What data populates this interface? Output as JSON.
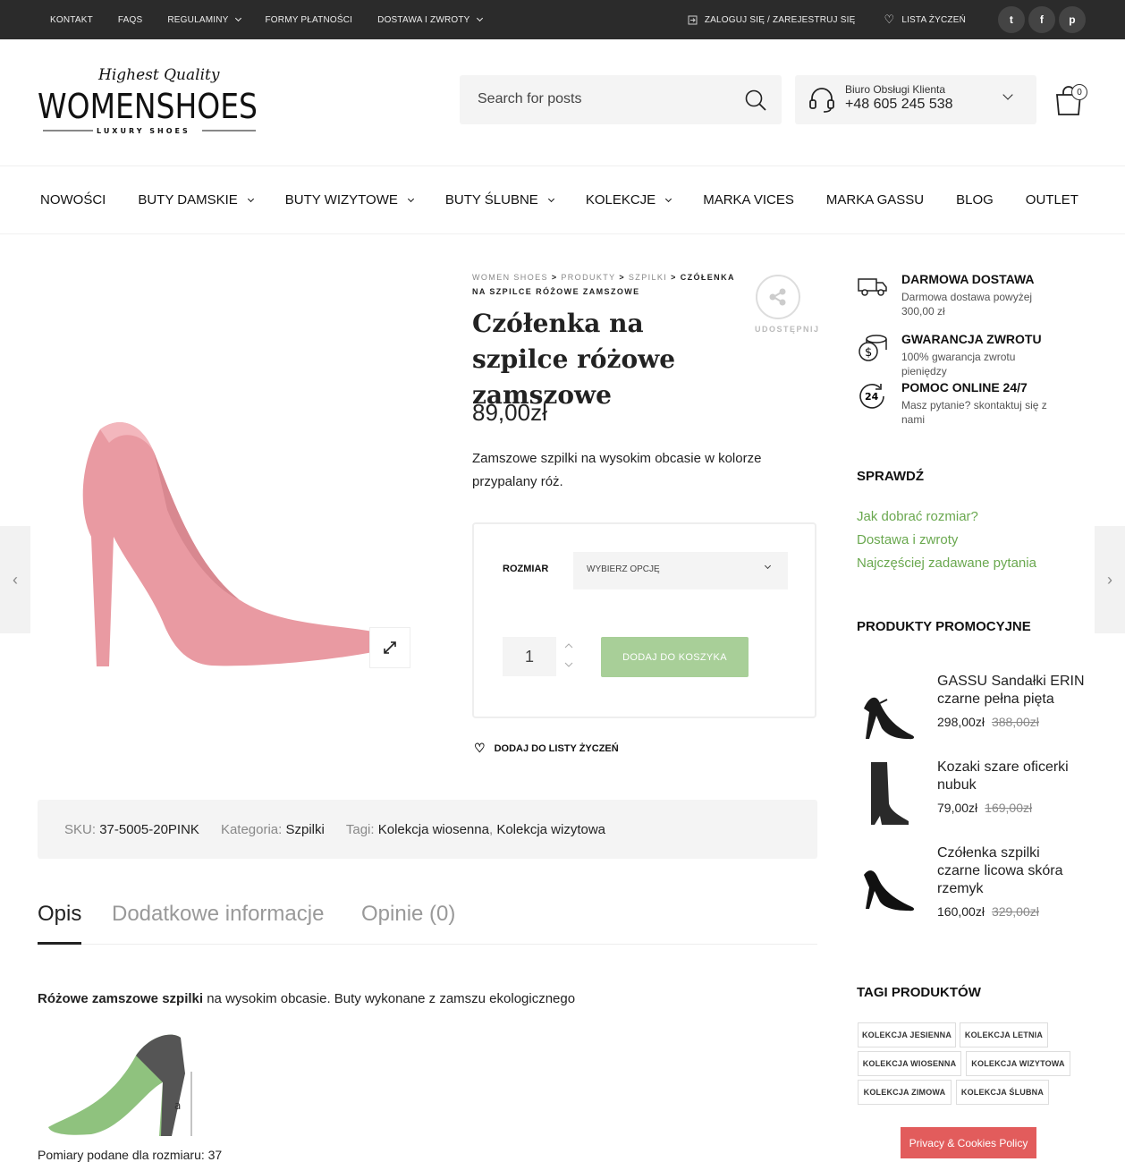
{
  "topbar": {
    "links": [
      "KONTAKT",
      "FAQS",
      "REGULAMINY",
      "FORMY PŁATNOŚCI",
      "DOSTAWA I ZWROTY"
    ],
    "login": "ZALOGUJ SIĘ / ZAREJESTRUJ SIĘ",
    "wishlist": "LISTA ŻYCZEŃ"
  },
  "logo": {
    "top": "Highest Quality",
    "main": "WOMENSHOES",
    "sub": "LUXURY SHOES"
  },
  "search": {
    "placeholder": "Search for posts"
  },
  "contact": {
    "label": "Biuro Obsługi Klienta",
    "phone": "+48 605 245 538"
  },
  "cart": {
    "count": "0"
  },
  "nav": [
    "NOWOŚCI",
    "BUTY DAMSKIE",
    "BUTY WIZYTOWE",
    "BUTY ŚLUBNE",
    "KOLEKCJE",
    "MARKA VICES",
    "MARKA GASSU",
    "BLOG",
    "OUTLET"
  ],
  "breadcrumb": {
    "items": [
      "WOMEN SHOES",
      "PRODUKTY",
      "SZPILKI"
    ],
    "current": "CZÓŁENKA NA SZPILCE RÓŻOWE ZAMSZOWE",
    "sep": ">"
  },
  "share": {
    "label": "UDOSTĘPNIJ"
  },
  "product": {
    "title": "Czółenka na szpilce różowe zamszowe",
    "price": "89,00zł",
    "description": "Zamszowe szpilki na wysokim obcasie w kolorze przypalany róż.",
    "size_label": "ROZMIAR",
    "size_select": "WYBIERZ OPCJĘ",
    "qty": "1",
    "add_to_cart": "DODAJ DO KOSZYKA",
    "wishlist": "DODAJ DO LISTY ŻYCZEŃ"
  },
  "meta": {
    "sku_label": "SKU:",
    "sku": "37-5005-20PINK",
    "cat_label": "Kategoria:",
    "category": "Szpilki",
    "tags_label": "Tagi:",
    "tag1": "Kolekcja wiosenna",
    "tag2": "Kolekcja wizytowa",
    "comma": ","
  },
  "tabs": [
    "Opis",
    "Dodatkowe informacje",
    "Opinie (0)"
  ],
  "description": {
    "bold": "Różowe zamszowe szpilki",
    "rest": " na wysokim obcasie. Buty wykonane z zamszu ekologicznego",
    "measure": "Pomiary podane dla rozmiaru: 37",
    "heel_letter": "a"
  },
  "features": [
    {
      "title": "DARMOWA DOSTAWA",
      "sub": "Darmowa dostawa powyżej 300,00 zł"
    },
    {
      "title": "GWARANCJA ZWROTU",
      "sub": "100% gwarancja zwrotu pieniędzy"
    },
    {
      "title": "POMOC ONLINE 24/7",
      "sub": "Masz pytanie? skontaktuj się z nami"
    }
  ],
  "check": {
    "heading": "SPRAWDŹ",
    "links": [
      "Jak dobrać rozmiar?",
      "Dostawa i zwroty",
      "Najczęściej zadawane pytania"
    ]
  },
  "promo": {
    "heading": "PRODUKTY PROMOCYJNE",
    "items": [
      {
        "name": "GASSU Sandałki ERIN czarne pełna pięta",
        "price": "298,00zł",
        "old": "388,00zł"
      },
      {
        "name": "Kozaki szare oficerki nubuk",
        "price": "79,00zł",
        "old": "169,00zł"
      },
      {
        "name": "Czółenka szpilki czarne licowa skóra rzemyk",
        "price": "160,00zł",
        "old": "329,00zł"
      }
    ]
  },
  "tags": {
    "heading": "TAGI PRODUKTÓW",
    "items": [
      "KOLEKCJA JESIENNA",
      "KOLEKCJA LETNIA",
      "KOLEKCJA WIOSENNA",
      "KOLEKCJA WIZYTOWA",
      "KOLEKCJA ZIMOWA",
      "KOLEKCJA ŚLUBNA"
    ]
  },
  "cookie": "Privacy & Cookies Policy",
  "colors": {
    "accent": "#a8cf98",
    "link": "#6aa84f",
    "topbar": "#2b2b2b",
    "cookie": "#e25c5c"
  }
}
